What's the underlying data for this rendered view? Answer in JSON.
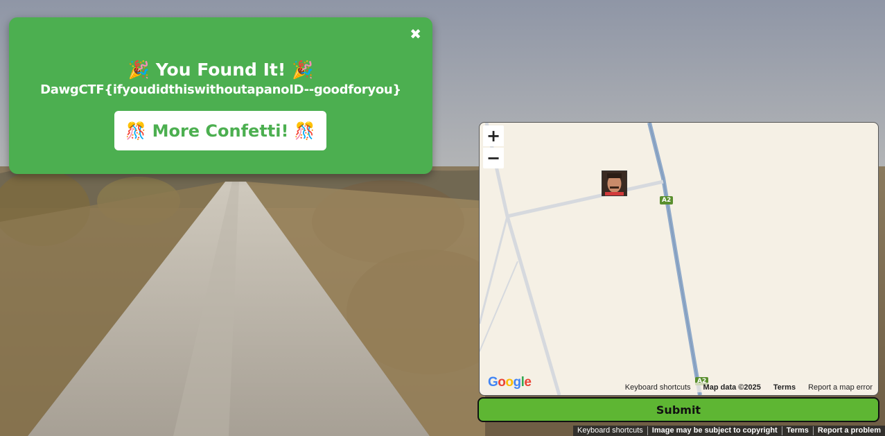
{
  "popup": {
    "close_label": "✖",
    "title": "🎉 You Found It! 🎉",
    "flag_text": "DawgCTF{ifyoudidthiswithoutapanoID--goodforyou}",
    "confetti_button": "🎊 More Confetti! 🎊"
  },
  "map": {
    "zoom_in_label": "+",
    "zoom_out_label": "−",
    "route_label": "A2",
    "logo_text": "Google",
    "footer": {
      "keyboard_shortcuts": "Keyboard shortcuts",
      "map_data": "Map data ©2025",
      "terms": "Terms",
      "report_error": "Report a map error"
    }
  },
  "submit_label": "Submit",
  "streetview_footer": {
    "keyboard_shortcuts": "Keyboard shortcuts",
    "copyright": "Image may be subject to copyright",
    "terms": "Terms",
    "report": "Report a problem"
  },
  "colors": {
    "popup_bg": "#4caf50",
    "submit_bg": "#5eb633",
    "road": "#8fa9c9"
  },
  "icons": [
    "close-icon",
    "zoom-in-icon",
    "zoom-out-icon",
    "map-marker-avatar-icon",
    "google-logo"
  ]
}
